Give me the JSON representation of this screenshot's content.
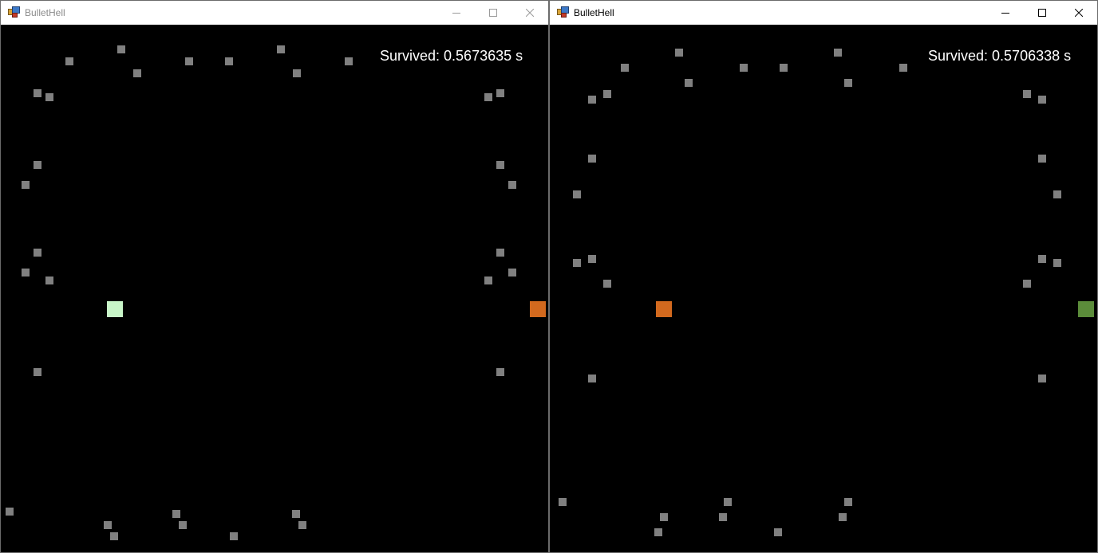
{
  "windows": [
    {
      "id": "left",
      "title": "BulletHell",
      "active": false,
      "hud_text": "Survived: 0.5673635 s",
      "player_color": "#c8f5c8",
      "enemy_color": "#d2691e"
    },
    {
      "id": "right",
      "title": "BulletHell",
      "active": true,
      "hud_text": "Survived: 0.5706338 s",
      "player_color": "#d2691e",
      "enemy_color": "#5b8c3a"
    }
  ],
  "colors": {
    "bullet": "#808080",
    "background": "#000000"
  },
  "icons": {
    "app": "winforms-app-icon",
    "minimize": "minimize-icon",
    "maximize": "maximize-icon",
    "close": "close-icon"
  }
}
